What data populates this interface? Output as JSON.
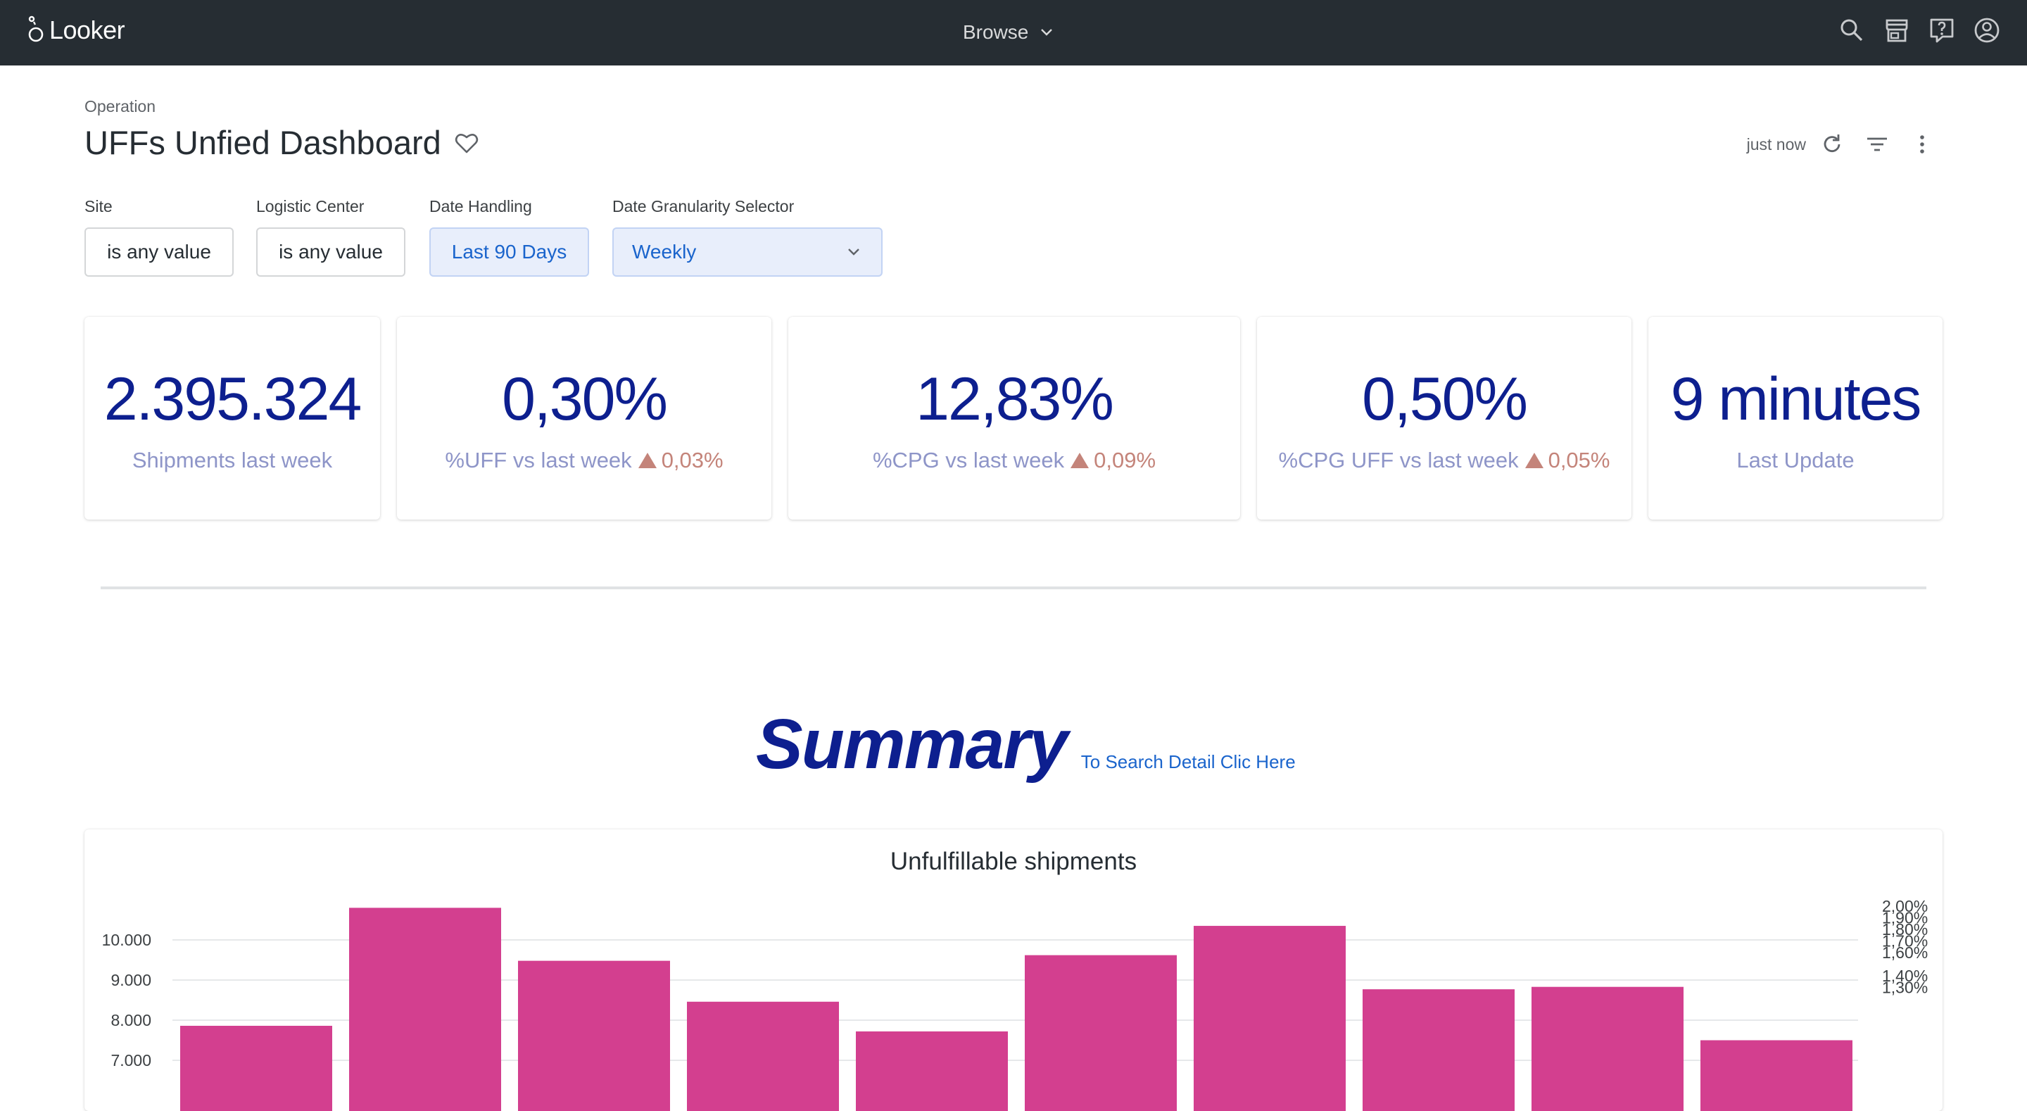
{
  "topbar": {
    "app_name": "Looker",
    "browse_label": "Browse",
    "icons": [
      "search-icon",
      "marketplace-icon",
      "help-icon",
      "account-icon"
    ]
  },
  "header": {
    "folder": "Operation",
    "title": "UFFs Unfied Dashboard",
    "updated": "just now"
  },
  "filters": [
    {
      "label": "Site",
      "value": "is any value"
    },
    {
      "label": "Logistic Center",
      "value": "is any value"
    },
    {
      "label": "Date Handling",
      "value": "Last 90 Days"
    },
    {
      "label": "Date Granularity Selector",
      "value": "Weekly"
    }
  ],
  "tiles": [
    {
      "value": "2.395.324",
      "label": "Shipments last week",
      "delta": ""
    },
    {
      "value": "0,30%",
      "label": "%UFF vs last week",
      "delta": "0,03%"
    },
    {
      "value": "12,83%",
      "label": "%CPG vs last week",
      "delta": "0,09%"
    },
    {
      "value": "0,50%",
      "label": "%CPG UFF vs last week",
      "delta": "0,05%"
    },
    {
      "value": "9 minutes",
      "label": "Last Update",
      "delta": ""
    }
  ],
  "summary": {
    "title": "Summary",
    "link": "To Search Detail Clic Here"
  },
  "colors": {
    "topbar": "#262d33",
    "kpi_value": "#0d1f8f",
    "kpi_label": "#8e95c8",
    "delta": "#c4847a",
    "bar": "#d33f8f",
    "link": "#1a64cc"
  },
  "chart_data": {
    "type": "bar",
    "title": "Unfulfillable shipments",
    "values": [
      7860,
      10800,
      9480,
      8460,
      7720,
      9620,
      10350,
      8770,
      8830,
      7500
    ],
    "y_ticks": [
      "10.000",
      "9.000",
      "8.000",
      "7.000"
    ],
    "y_tick_values": [
      10000,
      9000,
      8000,
      7000
    ],
    "y2_ticks": [
      "2,00%",
      "1,90%",
      "1,80%",
      "1,70%",
      "1,60%",
      "1,40%",
      "1,30%"
    ],
    "grid": true
  }
}
